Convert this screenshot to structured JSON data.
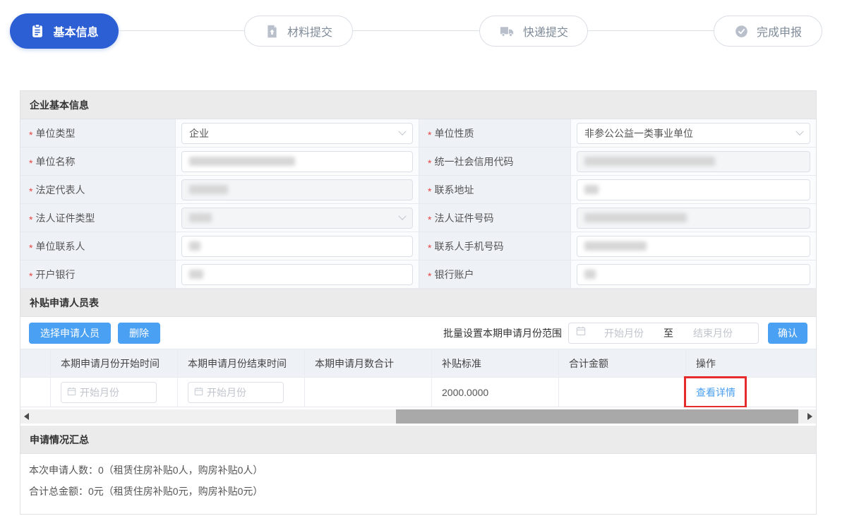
{
  "required_marker": "*",
  "colors": {
    "primary_blue": "#2b5fd3",
    "button_blue": "#4aa0f2",
    "link_blue": "#4a9ff0",
    "annotation_red": "#e52b2b"
  },
  "stepper": {
    "steps": [
      {
        "label": "基本信息",
        "state": "active",
        "icon": "clipboard-icon"
      },
      {
        "label": "材料提交",
        "state": "pending",
        "icon": "upload-file-icon"
      },
      {
        "label": "快递提交",
        "state": "pending",
        "icon": "truck-icon"
      },
      {
        "label": "完成申报",
        "state": "pending",
        "icon": "check-circle-icon"
      }
    ]
  },
  "company_info": {
    "title": "企业基本信息",
    "fields": [
      {
        "label": "单位类型",
        "type": "select",
        "value": "企业",
        "disabled": false
      },
      {
        "label": "单位性质",
        "type": "select",
        "value": "非参公公益一类事业单位",
        "disabled": false
      },
      {
        "label": "单位名称",
        "type": "text",
        "redacted": true
      },
      {
        "label": "统一社会信用代码",
        "type": "text",
        "redacted": true,
        "disabled": true
      },
      {
        "label": "法定代表人",
        "type": "text",
        "redacted": true,
        "disabled": true
      },
      {
        "label": "联系地址",
        "type": "text",
        "redacted": true
      },
      {
        "label": "法人证件类型",
        "type": "select",
        "redacted": true,
        "disabled": true
      },
      {
        "label": "法人证件号码",
        "type": "text",
        "redacted": true,
        "disabled": true
      },
      {
        "label": "单位联系人",
        "type": "text",
        "redacted": true
      },
      {
        "label": "联系人手机号码",
        "type": "text",
        "redacted": true
      },
      {
        "label": "开户银行",
        "type": "text",
        "redacted": true
      },
      {
        "label": "银行账户",
        "type": "text",
        "redacted": true
      }
    ]
  },
  "personnel": {
    "title": "补贴申请人员表",
    "select_button": "选择申请人员",
    "delete_button": "删除",
    "batch_label": "批量设置本期申请月份范围",
    "batch_start_placeholder": "开始月份",
    "batch_separator": "至",
    "batch_end_placeholder": "结束月份",
    "confirm_button": "确认",
    "columns": {
      "checkbox": "",
      "start": "本期申请月份开始时间",
      "end": "本期申请月份结束时间",
      "months": "本期申请月数合计",
      "standard": "补贴标准",
      "amount": "合计金额",
      "action": "操作"
    },
    "row": {
      "start_placeholder": "开始月份",
      "end_placeholder": "开始月份",
      "months_total": "",
      "standard": "2000.0000",
      "amount": "",
      "action_link": "查看详情"
    }
  },
  "summary": {
    "title": "申请情况汇总",
    "line1": "本次申请人数：0（租赁住房补贴0人，购房补贴0人）",
    "line2": "合计总金额：0元（租赁住房补贴0元，购房补贴0元）"
  }
}
